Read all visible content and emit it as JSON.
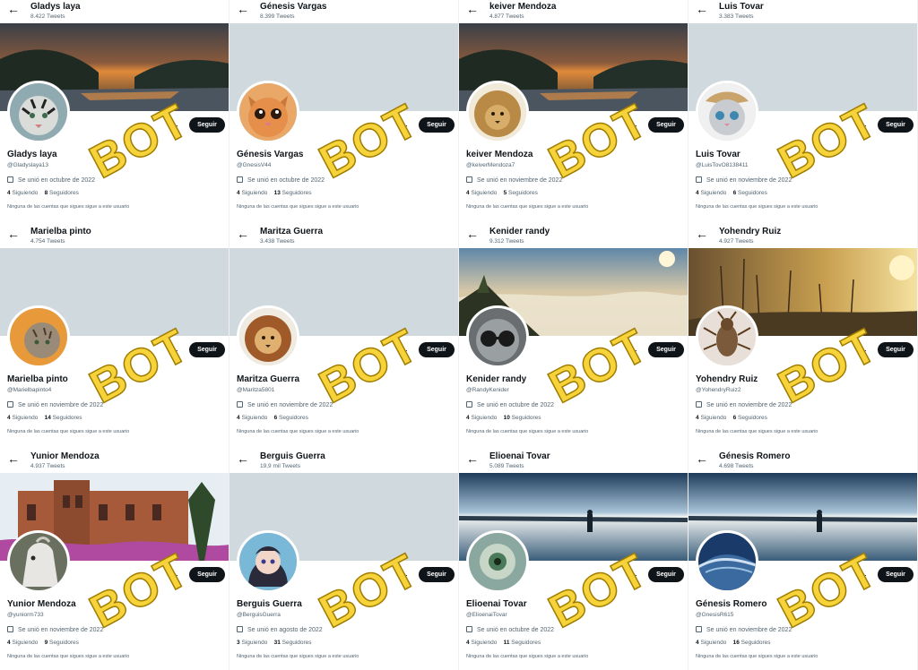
{
  "watermark": "BOT",
  "profiles": [
    {
      "header_name": "Gladys laya",
      "tweets": "8.422 Tweets",
      "name": "Gladys laya",
      "handle": "@Gladyslaya13",
      "joined": "Se unió en octubre de 2022",
      "following": "4",
      "following_label": "Siguiendo",
      "followers": "8",
      "followers_label": "Seguidores",
      "note": "Ninguna de las cuentas que sigues sigue a este usuario",
      "follow_label": "Seguir",
      "banner": "sunset-river",
      "avatar": "tiger"
    },
    {
      "header_name": "Génesis Vargas",
      "tweets": "8.399 Tweets",
      "name": "Génesis Vargas",
      "handle": "@GnesisV44",
      "joined": "Se unió en octubre de 2022",
      "following": "4",
      "following_label": "Siguiendo",
      "followers": "13",
      "followers_label": "Seguidores",
      "note": "Ninguna de las cuentas que sigues sigue a este usuario",
      "follow_label": "Seguir",
      "banner": "plain",
      "avatar": "orange-cat"
    },
    {
      "header_name": "keiver Mendoza",
      "tweets": "4.877 Tweets",
      "name": "keiver Mendoza",
      "handle": "@keiverMendoza7",
      "joined": "Se unió en noviembre de 2022",
      "following": "4",
      "following_label": "Siguiendo",
      "followers": "5",
      "followers_label": "Seguidores",
      "note": "Ninguna de las cuentas que sigues sigue a este usuario",
      "follow_label": "Seguir",
      "banner": "sunset-river",
      "avatar": "lion"
    },
    {
      "header_name": "Luis Tovar",
      "tweets": "3.383 Tweets",
      "name": "Luis Tovar",
      "handle": "@LuisTovO8138411",
      "joined": "Se unió en noviembre de 2022",
      "following": "4",
      "following_label": "Siguiendo",
      "followers": "6",
      "followers_label": "Seguidores",
      "note": "Ninguna de las cuentas que sigues sigue a este usuario",
      "follow_label": "Seguir",
      "banner": "plain",
      "avatar": "hat-cat"
    },
    {
      "header_name": "Marielba pinto",
      "tweets": "4.754 Tweets",
      "name": "Marielba pinto",
      "handle": "@Marielbapinto4",
      "joined": "Se unió en noviembre de 2022",
      "following": "4",
      "following_label": "Siguiendo",
      "followers": "14",
      "followers_label": "Seguidores",
      "note": "Ninguna de las cuentas que sigues sigue a este usuario",
      "follow_label": "Seguir",
      "banner": "plain",
      "avatar": "tabby-cat"
    },
    {
      "header_name": "Maritza Guerra",
      "tweets": "3.438 Tweets",
      "name": "Maritza Guerra",
      "handle": "@Maritza5801",
      "joined": "Se unió en noviembre de 2022",
      "following": "4",
      "following_label": "Siguiendo",
      "followers": "6",
      "followers_label": "Seguidores",
      "note": "Ninguna de las cuentas que sigues sigue a este usuario",
      "follow_label": "Seguir",
      "banner": "plain",
      "avatar": "lion-art"
    },
    {
      "header_name": "Kenider randy",
      "tweets": "9.312 Tweets",
      "name": "Kenider randy",
      "handle": "@RandyKenider",
      "joined": "Se unió en octubre de 2022",
      "following": "4",
      "following_label": "Siguiendo",
      "followers": "10",
      "followers_label": "Seguidores",
      "note": "Ninguna de las cuentas que sigues sigue a este usuario",
      "follow_label": "Seguir",
      "banner": "mountain-clouds",
      "avatar": "sunglasses-cat"
    },
    {
      "header_name": "Yohendry Ruiz",
      "tweets": "4.927 Tweets",
      "name": "Yohendry Ruiz",
      "handle": "@YohendryRuiz2",
      "joined": "Se unió en noviembre de 2022",
      "following": "4",
      "following_label": "Siguiendo",
      "followers": "6",
      "followers_label": "Seguidores",
      "note": "Ninguna de las cuentas que sigues sigue a este usuario",
      "follow_label": "Seguir",
      "banner": "golden-grass",
      "avatar": "insect"
    },
    {
      "header_name": "Yunior Mendoza",
      "tweets": "4.937 Tweets",
      "name": "Yunior Mendoza",
      "handle": "@yuniorm733",
      "joined": "Se unió en noviembre de 2022",
      "following": "4",
      "following_label": "Siguiendo",
      "followers": "9",
      "followers_label": "Seguidores",
      "note": "Ninguna de las cuentas que sigues sigue a este usuario",
      "follow_label": "Seguir",
      "banner": "palace",
      "avatar": "horse"
    },
    {
      "header_name": "Berguis Guerra",
      "tweets": "19,9 mil Tweets",
      "name": "Berguis Guerra",
      "handle": "@BerguisGuerra",
      "joined": "Se unió en agosto de 2022",
      "following": "3",
      "following_label": "Siguiendo",
      "followers": "31",
      "followers_label": "Seguidores",
      "note": "Ninguna de las cuentas que sigues sigue a este usuario",
      "follow_label": "Seguir",
      "banner": "plain",
      "avatar": "anime-girl"
    },
    {
      "header_name": "Elioenai Tovar",
      "tweets": "5.089 Tweets",
      "name": "Elioenai Tovar",
      "handle": "@ElioenaiTovar",
      "joined": "Se unió en octubre de 2022",
      "following": "4",
      "following_label": "Siguiendo",
      "followers": "11",
      "followers_label": "Seguidores",
      "note": "Ninguna de las cuentas que sigues sigue a este usuario",
      "follow_label": "Seguir",
      "banner": "lake-person",
      "avatar": "green-eye"
    },
    {
      "header_name": "Génesis Romero",
      "tweets": "4.698 Tweets",
      "name": "Génesis Romero",
      "handle": "@GnesisR615",
      "joined": "Se unió en noviembre de 2022",
      "following": "4",
      "following_label": "Siguiendo",
      "followers": "16",
      "followers_label": "Seguidores",
      "note": "Ninguna de las cuentas que sigues sigue a este usuario",
      "follow_label": "Seguir",
      "banner": "lake-person",
      "avatar": "blue-wave"
    }
  ]
}
